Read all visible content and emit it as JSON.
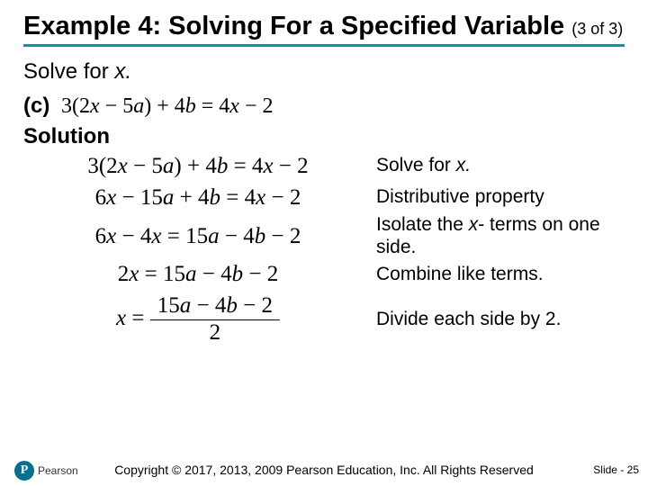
{
  "title_main": "Example 4: Solving For a Specified Variable",
  "title_pager": "(3 of 3)",
  "prompt_prefix": "Solve for ",
  "prompt_var": "x.",
  "part_label": "(c)",
  "part_equation_lhs1": "3(2",
  "part_equation_x1": "x",
  "part_equation_mid1": " − 5",
  "part_equation_a1": "a",
  "part_equation_rhs1": ") + 4",
  "part_equation_b1": "b",
  "part_equation_eq1": " = 4",
  "part_equation_x2": "x",
  "part_equation_tail1": " − 2",
  "solution_label": "Solution",
  "steps": [
    {
      "eq_html": "3(2<span class='em'>x</span> − 5<span class='em'>a</span>) + 4<span class='em'>b</span> = 4<span class='em'>x</span> − 2",
      "explain_html": "Solve for <span class='em'>x.</span>"
    },
    {
      "eq_html": "6<span class='em'>x</span> − 15<span class='em'>a</span> + 4<span class='em'>b</span> = 4<span class='em'>x</span> − 2",
      "explain_html": "Distributive property"
    },
    {
      "eq_html": "6<span class='em'>x</span> − 4<span class='em'>x</span> = 15<span class='em'>a</span> − 4<span class='em'>b</span> − 2",
      "explain_html": "Isolate the <span class='em'>x</span>- terms on one side."
    },
    {
      "eq_html": "2<span class='em'>x</span> = 15<span class='em'>a</span> − 4<span class='em'>b</span> − 2",
      "explain_html": "Combine like terms."
    },
    {
      "eq_html": "<span class='em'>x</span> = <span class='frac'><span class='num'>15<span class=\"em\">a</span> − 4<span class=\"em\">b</span> − 2</span><span class='den'>2</span></span>",
      "explain_html": "Divide each side by 2."
    }
  ],
  "copyright": "Copyright © 2017, 2013, 2009 Pearson Education, Inc. All Rights Reserved",
  "slide_number": "Slide - 25",
  "logo_text": "Pearson",
  "logo_letter": "P"
}
